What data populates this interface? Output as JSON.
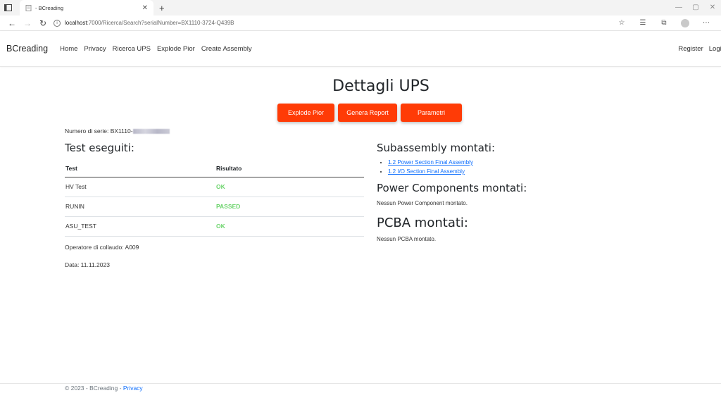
{
  "browser": {
    "tab_title": "- BCreading",
    "url_host": "localhost",
    "url_path": ":7000/Ricerca/Search?serialNumber=BX1110-3724-Q439B"
  },
  "nav": {
    "brand": "BCreading",
    "links": [
      "Home",
      "Privacy",
      "Ricerca UPS",
      "Explode Pior",
      "Create Assembly"
    ],
    "register": "Register",
    "login": "Login"
  },
  "page": {
    "title": "Dettagli UPS",
    "buttons": [
      "Explode Pior",
      "Genera Report",
      "Parametri"
    ],
    "serial_label": "Numero di serie: BX1110-"
  },
  "tests": {
    "heading": "Test eseguiti:",
    "columns": [
      "Test",
      "Risultato"
    ],
    "rows": [
      {
        "test": "HV Test",
        "result": "OK"
      },
      {
        "test": "RUNIN",
        "result": "PASSED"
      },
      {
        "test": "ASU_TEST",
        "result": "OK"
      }
    ],
    "operator": "Operatore di collaudo: A009",
    "date": "Data: 11.11.2023"
  },
  "subassembly": {
    "heading": "Subassembly montati:",
    "items": [
      "1.2 Power Section Final Assembly",
      "1.2 I/O Section Final Assembly"
    ]
  },
  "power": {
    "heading": "Power Components montati:",
    "empty": "Nessun Power Component montato."
  },
  "pcba": {
    "heading": "PCBA montati:",
    "empty": "Nessun PCBA montato."
  },
  "footer": {
    "text": "© 2023 - BCreading - ",
    "privacy": "Privacy"
  },
  "colors": {
    "accent_button": "#ff3b06",
    "ok_green": "#6dd46d",
    "link_blue": "#0d6efd"
  }
}
